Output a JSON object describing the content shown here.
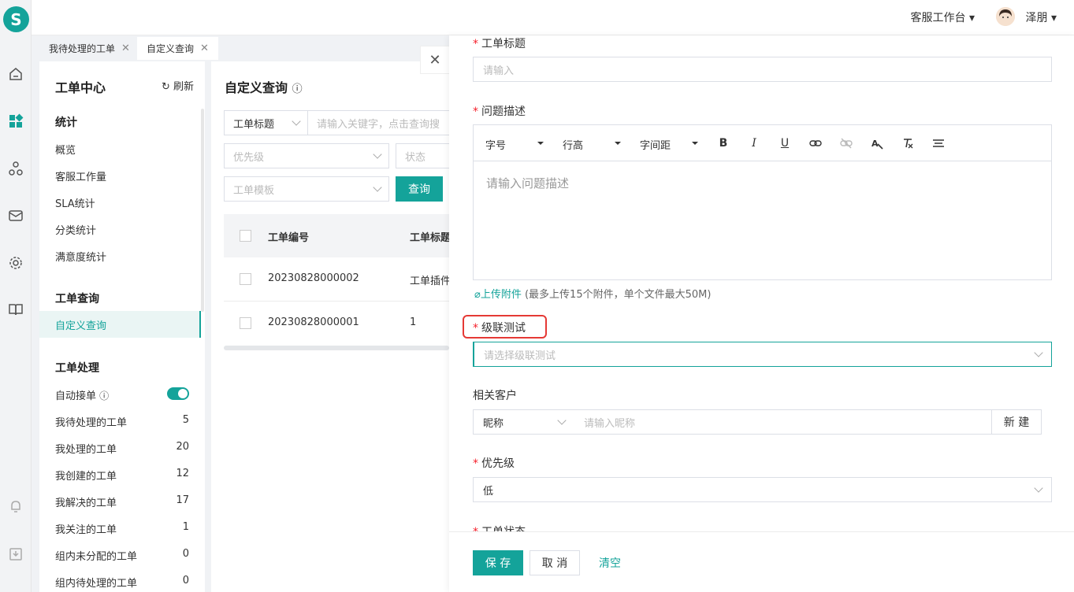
{
  "topbar": {
    "workspace": "客服工作台",
    "username": "泽朋"
  },
  "tabs": [
    {
      "label": "我待处理的工单"
    },
    {
      "label": "自定义查询"
    }
  ],
  "sidebar": {
    "title": "工单中心",
    "refresh": "刷新",
    "stats_section": "统计",
    "stats_items": [
      "概览",
      "客服工作量",
      "SLA统计",
      "分类统计",
      "满意度统计"
    ],
    "query_section": "工单查询",
    "query_items": [
      "自定义查询"
    ],
    "handle_section": "工单处理",
    "auto_accept": "自动接单",
    "handle_items": [
      {
        "label": "我待处理的工单",
        "count": "5"
      },
      {
        "label": "我处理的工单",
        "count": "20"
      },
      {
        "label": "我创建的工单",
        "count": "12"
      },
      {
        "label": "我解决的工单",
        "count": "17"
      },
      {
        "label": "我关注的工单",
        "count": "1"
      },
      {
        "label": "组内未分配的工单",
        "count": "0"
      },
      {
        "label": "组内待处理的工单",
        "count": "0"
      }
    ]
  },
  "main": {
    "title": "自定义查询",
    "filter_field": "工单标题",
    "keyword_placeholder": "请输入关键字，点击查询搜",
    "priority_placeholder": "优先级",
    "status_placeholder": "状态",
    "template_placeholder": "工单模板",
    "query_button": "查询",
    "table": {
      "headers": [
        "工单编号",
        "工单标题"
      ],
      "rows": [
        {
          "id": "20230828000002",
          "title": "工单插件"
        },
        {
          "id": "20230828000001",
          "title": "1"
        }
      ]
    }
  },
  "drawer": {
    "title_label": "工单标题",
    "title_placeholder": "请输入",
    "desc_label": "问题描述",
    "editor": {
      "font_size": "字号",
      "line_height": "行高",
      "letter_spacing": "字间距",
      "placeholder": "请输入问题描述"
    },
    "upload": "上传附件",
    "upload_hint": "(最多上传15个附件，单个文件最大50M)",
    "cascade_label": "级联测试",
    "cascade_placeholder": "请选择级联测试",
    "customer_label": "相关客户",
    "customer_type": "昵称",
    "customer_placeholder": "请输入昵称",
    "new_button": "新 建",
    "priority_label": "优先级",
    "priority_value": "低",
    "status_label": "工单状态",
    "save": "保 存",
    "cancel": "取 消",
    "clear": "清空"
  },
  "colors": {
    "accent": "#14a39a",
    "required": "#f5222d",
    "highlight": "#e53935"
  }
}
